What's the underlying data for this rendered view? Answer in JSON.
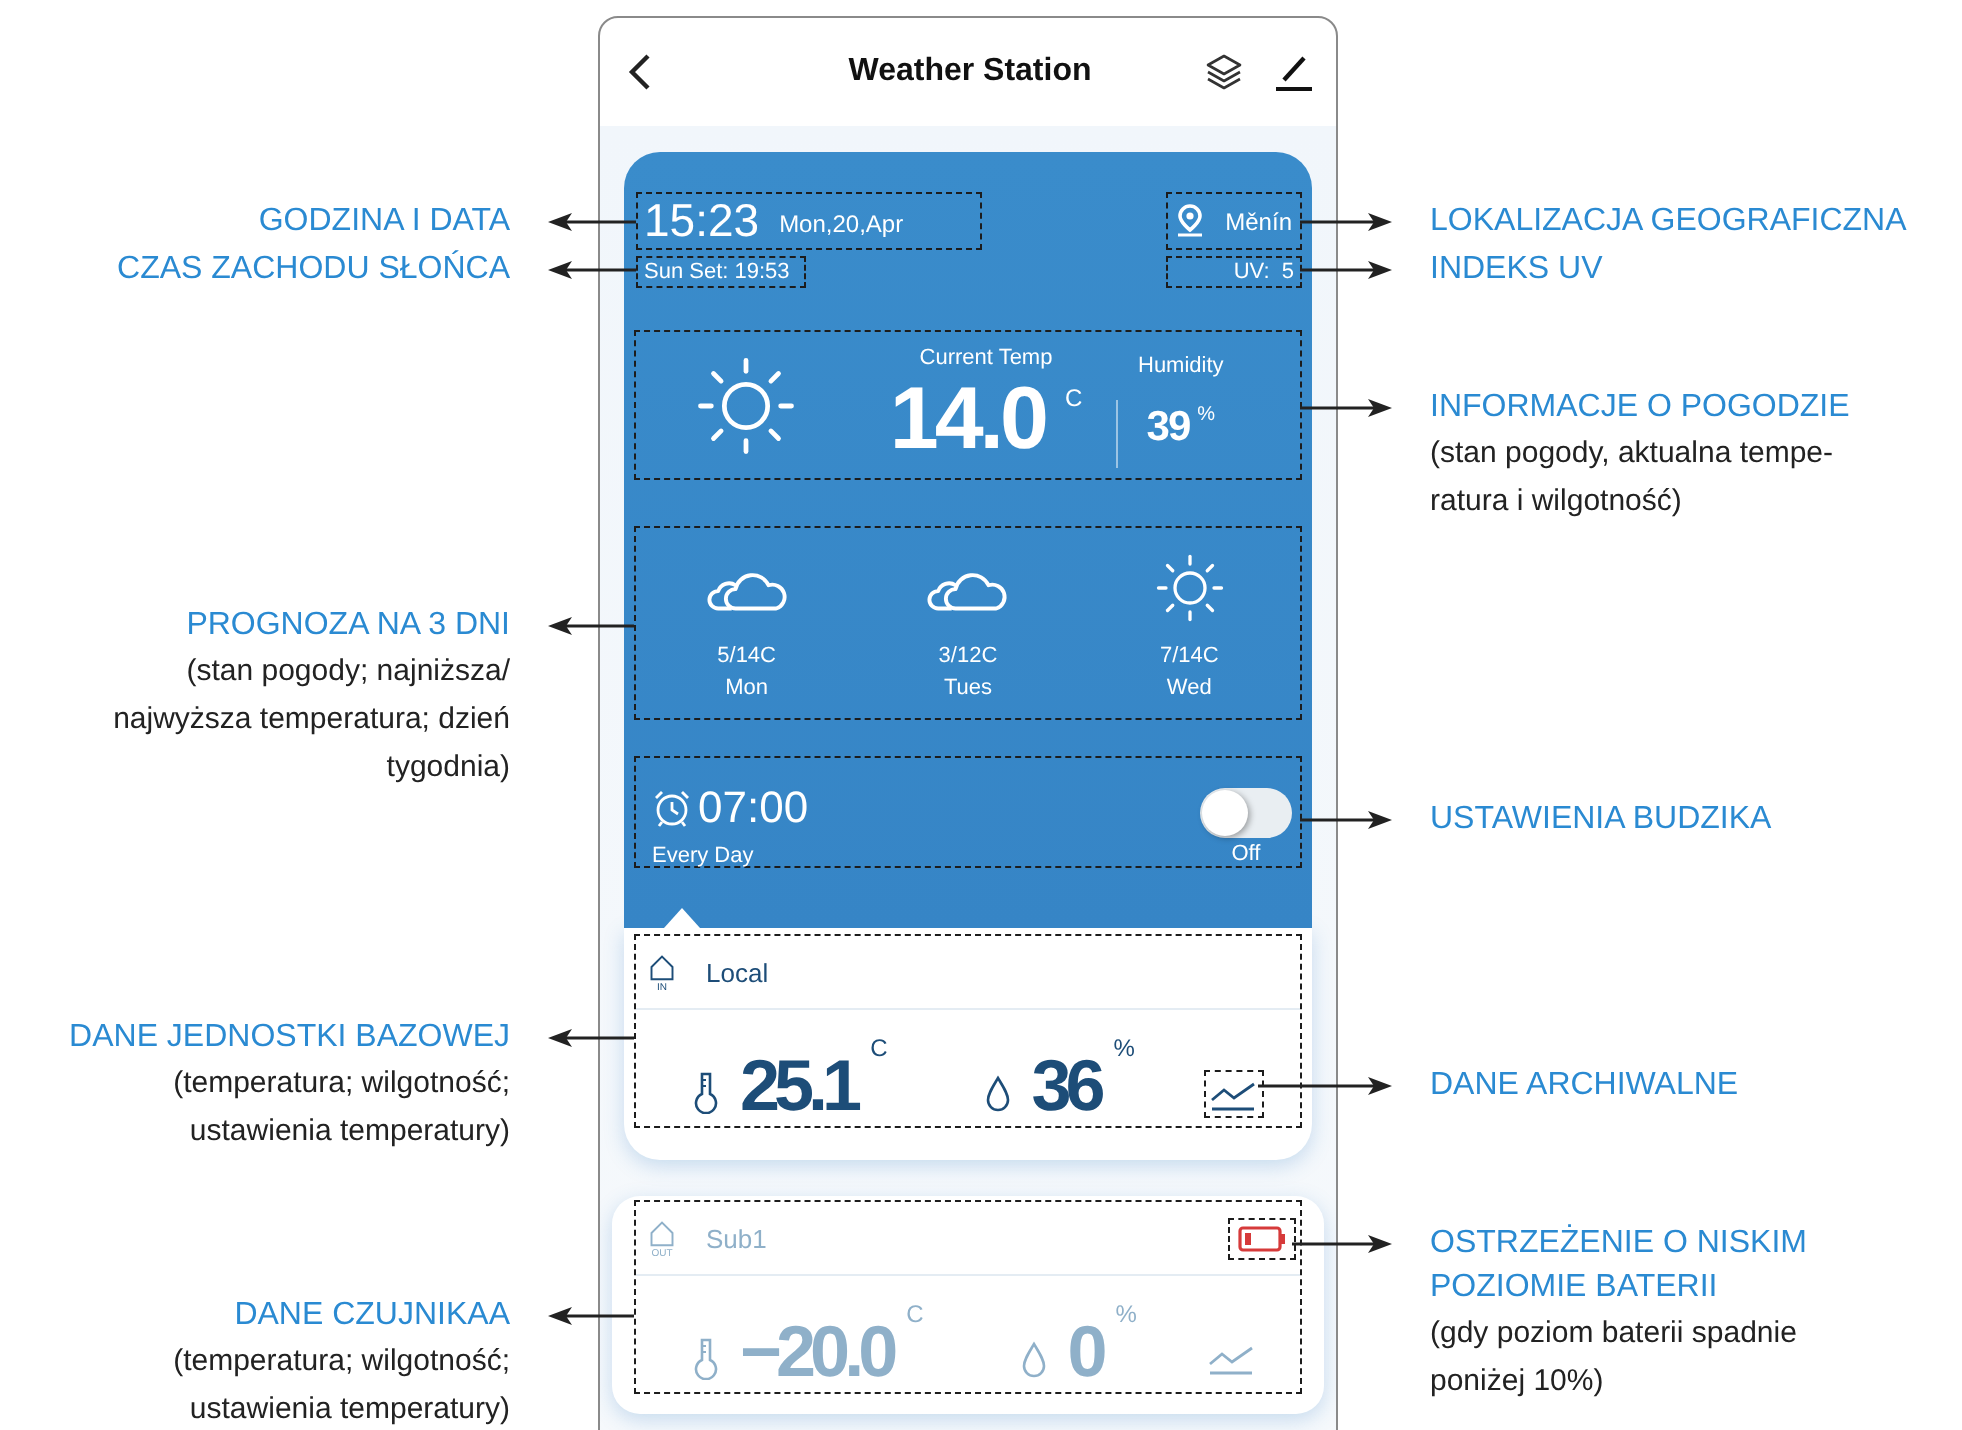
{
  "app": {
    "title": "Weather Station"
  },
  "top": {
    "time": "15:23",
    "date": "Mon,20,Apr",
    "sunset": "Sun Set: 19:53",
    "location": "Měnín",
    "uv": "UV:  5"
  },
  "current": {
    "label": "Current Temp",
    "kind": "sunny",
    "temp": "14.0",
    "unit": "C",
    "humidity_label": "Humidity",
    "humidity": "39",
    "humidity_unit": "%"
  },
  "forecast": [
    {
      "kind": "cloudy",
      "range": "5/14C",
      "day": "Mon"
    },
    {
      "kind": "cloudy",
      "range": "3/12C",
      "day": "Tues"
    },
    {
      "kind": "sunny",
      "range": "7/14C",
      "day": "Wed"
    }
  ],
  "alarm": {
    "time": "07:00",
    "repeat": "Every Day",
    "on": false,
    "state": "Off"
  },
  "sensors": [
    {
      "kind": "base",
      "badge": "IN",
      "name": "Local",
      "temp": "25.1",
      "temp_unit": "C",
      "humidity": "36",
      "humidity_unit": "%",
      "low_battery": false
    },
    {
      "kind": "remote",
      "badge": "OUT",
      "name": "Sub1",
      "temp": "−20.0",
      "temp_unit": "C",
      "humidity": "0",
      "humidity_unit": "%",
      "low_battery": true
    }
  ],
  "callouts": [
    {
      "kind": "left",
      "title": "GODZINA I DATA"
    },
    {
      "kind": "left",
      "title": "CZAS ZACHODU SŁOŃCA"
    },
    {
      "kind": "left",
      "title": "PROGNOZA NA 3 DNI",
      "note": "(stan pogody; najniższa/ najwyższa temperatura; dzień tygodnia)"
    },
    {
      "kind": "left",
      "title": "DANE JEDNOSTKI BAZOWEJ",
      "note": "(temperatura; wilgotność; ustawienia temperatury)"
    },
    {
      "kind": "left",
      "title": "DANE CZUJNIKAA",
      "note": "(temperatura; wilgotność; ustawienia temperatury)"
    },
    {
      "kind": "right",
      "title": "LOKALIZACJA GEOGRAFICZNA"
    },
    {
      "kind": "right",
      "title": "INDEKS UV"
    },
    {
      "kind": "right",
      "title": "INFORMACJE O POGODZIE",
      "note": "(stan pogody, aktualna tempe-ratura i wilgotność)"
    },
    {
      "kind": "right",
      "title": "USTAWIENIA BUDZIKA"
    },
    {
      "kind": "right",
      "title": "DANE ARCHIWALNE"
    },
    {
      "kind": "right",
      "title": "OSTRZEŻENIE O NISKIM POZIOMIE BATERII",
      "note": "(gdy poziom baterii spadnie poniżej 10%)"
    }
  ]
}
